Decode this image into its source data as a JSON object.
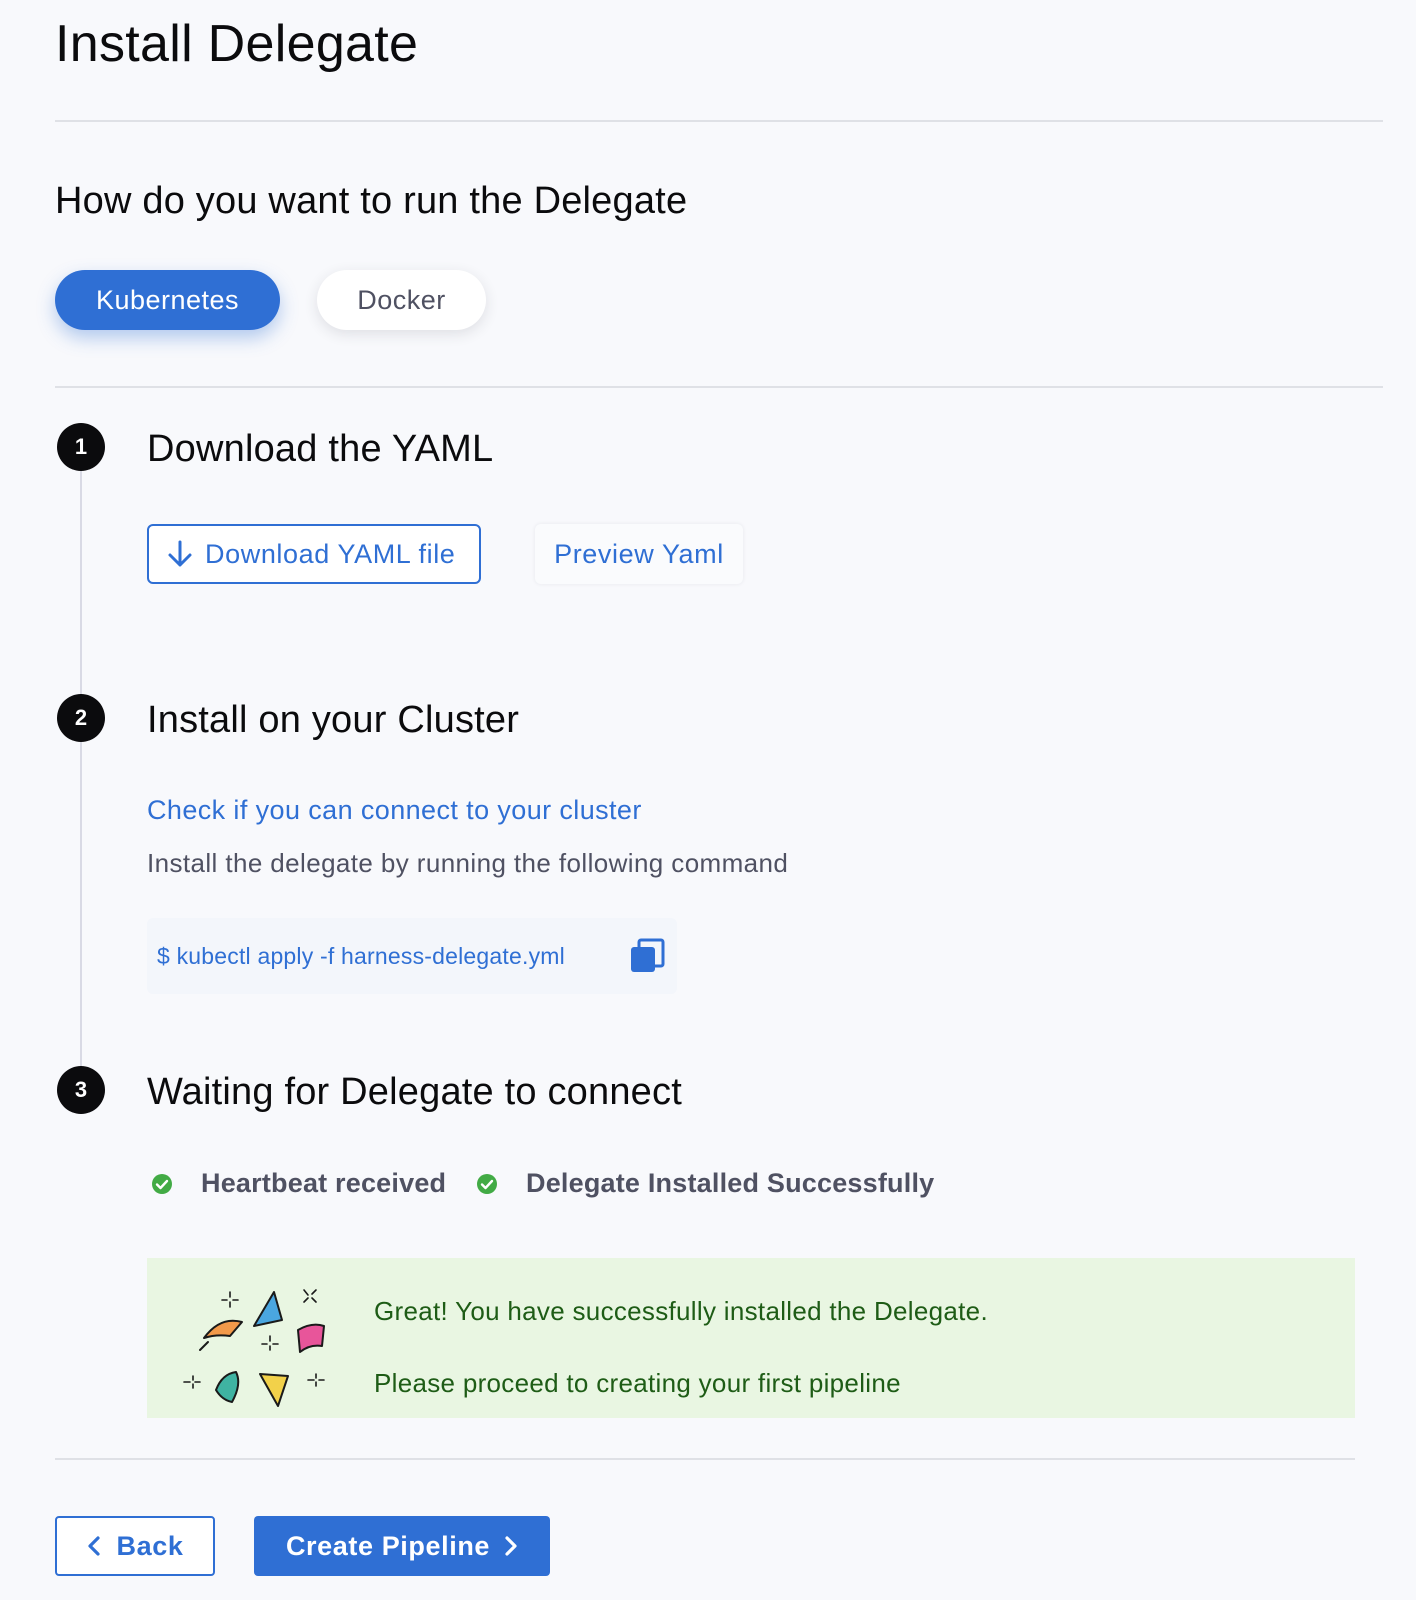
{
  "page": {
    "title": "Install Delegate"
  },
  "run_mode": {
    "question": "How do you want to run the Delegate",
    "options": [
      {
        "label": "Kubernetes",
        "selected": true
      },
      {
        "label": "Docker",
        "selected": false
      }
    ]
  },
  "steps": [
    {
      "number": "1",
      "title": "Download the YAML",
      "download_button": "Download YAML file",
      "preview_button": "Preview Yaml"
    },
    {
      "number": "2",
      "title": "Install on your Cluster",
      "check_link": "Check if you can connect to your cluster",
      "instruction": "Install the delegate by running the following command",
      "command": "$ kubectl apply -f harness-delegate.yml"
    },
    {
      "number": "3",
      "title": "Waiting for Delegate to connect",
      "statuses": [
        {
          "label": "Heartbeat received",
          "state": "success"
        },
        {
          "label": "Delegate Installed Successfully",
          "state": "success"
        }
      ],
      "success_message": {
        "line1": "Great! You have successfully installed the Delegate.",
        "line2": "Please proceed to creating your first pipeline"
      }
    }
  ],
  "footer": {
    "back_label": "Back",
    "create_label": "Create Pipeline"
  },
  "icons": {
    "download": "arrow-down-icon",
    "copy": "copy-icon",
    "check": "check-circle-icon",
    "back": "chevron-left-icon",
    "next": "chevron-right-icon",
    "celebration": "confetti-illustration"
  },
  "colors": {
    "primary": "#2f6fd4",
    "success_green": "#42ab45",
    "success_bg": "#e9f6e2",
    "success_text": "#1e5c16",
    "text_dark": "#0b0b0d",
    "text_muted": "#4f5162"
  }
}
